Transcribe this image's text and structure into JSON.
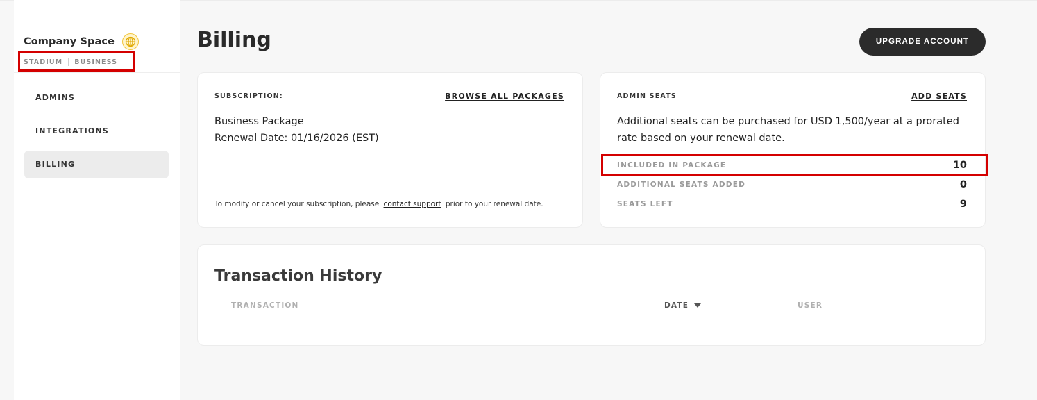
{
  "sidebar": {
    "brand_name": "Company Space",
    "brand_tag_1": "STADIUM",
    "brand_tag_2": "BUSINESS",
    "items": [
      {
        "label": "ADMINS"
      },
      {
        "label": "INTEGRATIONS"
      },
      {
        "label": "BILLING",
        "active": true
      }
    ]
  },
  "header": {
    "title": "Billing",
    "upgrade_label": "UPGRADE ACCOUNT"
  },
  "subscription": {
    "label": "SUBSCRIPTION:",
    "browse_link": "BROWSE ALL PACKAGES",
    "package_name": "Business Package",
    "renewal": "Renewal Date: 01/16/2026 (EST)",
    "note_before": "To modify or cancel your subscription, please",
    "note_link": "contact support",
    "note_after": "prior to your renewal date."
  },
  "admin_seats": {
    "label": "ADMIN SEATS",
    "add_link": "ADD SEATS",
    "description": "Additional seats can be purchased for USD 1,500/year at a prorated rate based on your renewal date.",
    "rows": [
      {
        "label": "INCLUDED IN PACKAGE",
        "value": "10"
      },
      {
        "label": "ADDITIONAL SEATS ADDED",
        "value": "0"
      },
      {
        "label": "SEATS LEFT",
        "value": "9"
      }
    ]
  },
  "transactions": {
    "title": "Transaction History",
    "columns": {
      "transaction": "TRANSACTION",
      "date": "DATE",
      "user": "USER"
    }
  },
  "colors": {
    "accent_dark": "#2b2b2b",
    "highlight_red": "#d40000",
    "brand_gold": "#f2c53d"
  },
  "icons": {
    "brand": "globe-coin-icon",
    "sort": "caret-down-icon"
  }
}
